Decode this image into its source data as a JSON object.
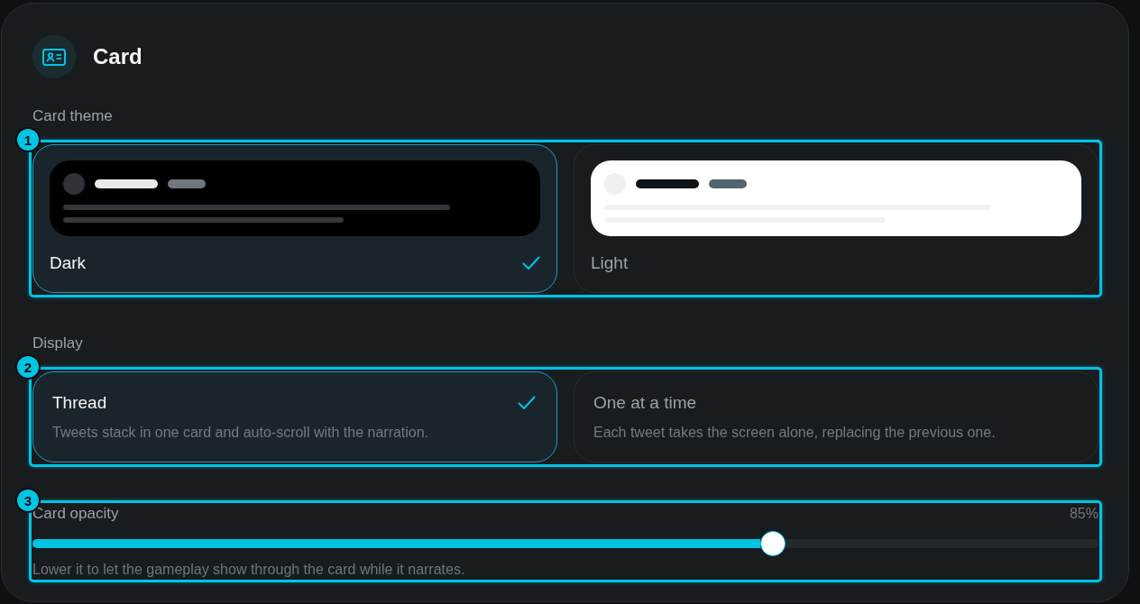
{
  "panel": {
    "title": "Card"
  },
  "sections": [
    {
      "kind": "theme-choice",
      "label": "Card theme",
      "callout": "1",
      "options": [
        {
          "label": "Dark",
          "kind": "dark",
          "selected": true
        },
        {
          "label": "Light",
          "kind": "light",
          "selected": false
        }
      ]
    },
    {
      "kind": "text-choice",
      "label": "Display",
      "callout": "2",
      "options": [
        {
          "title": "Thread",
          "description": "Tweets stack in one card and auto-scroll with the narration.",
          "selected": true
        },
        {
          "title": "One at a time",
          "description": "Each tweet takes the screen alone, replacing the previous one.",
          "selected": false
        }
      ]
    },
    {
      "kind": "slider",
      "label": "Card opacity",
      "callout": "3",
      "reading": "85%",
      "level": 0.695,
      "hint": "Lower it to let the gameplay show through the card while it narrates."
    }
  ]
}
